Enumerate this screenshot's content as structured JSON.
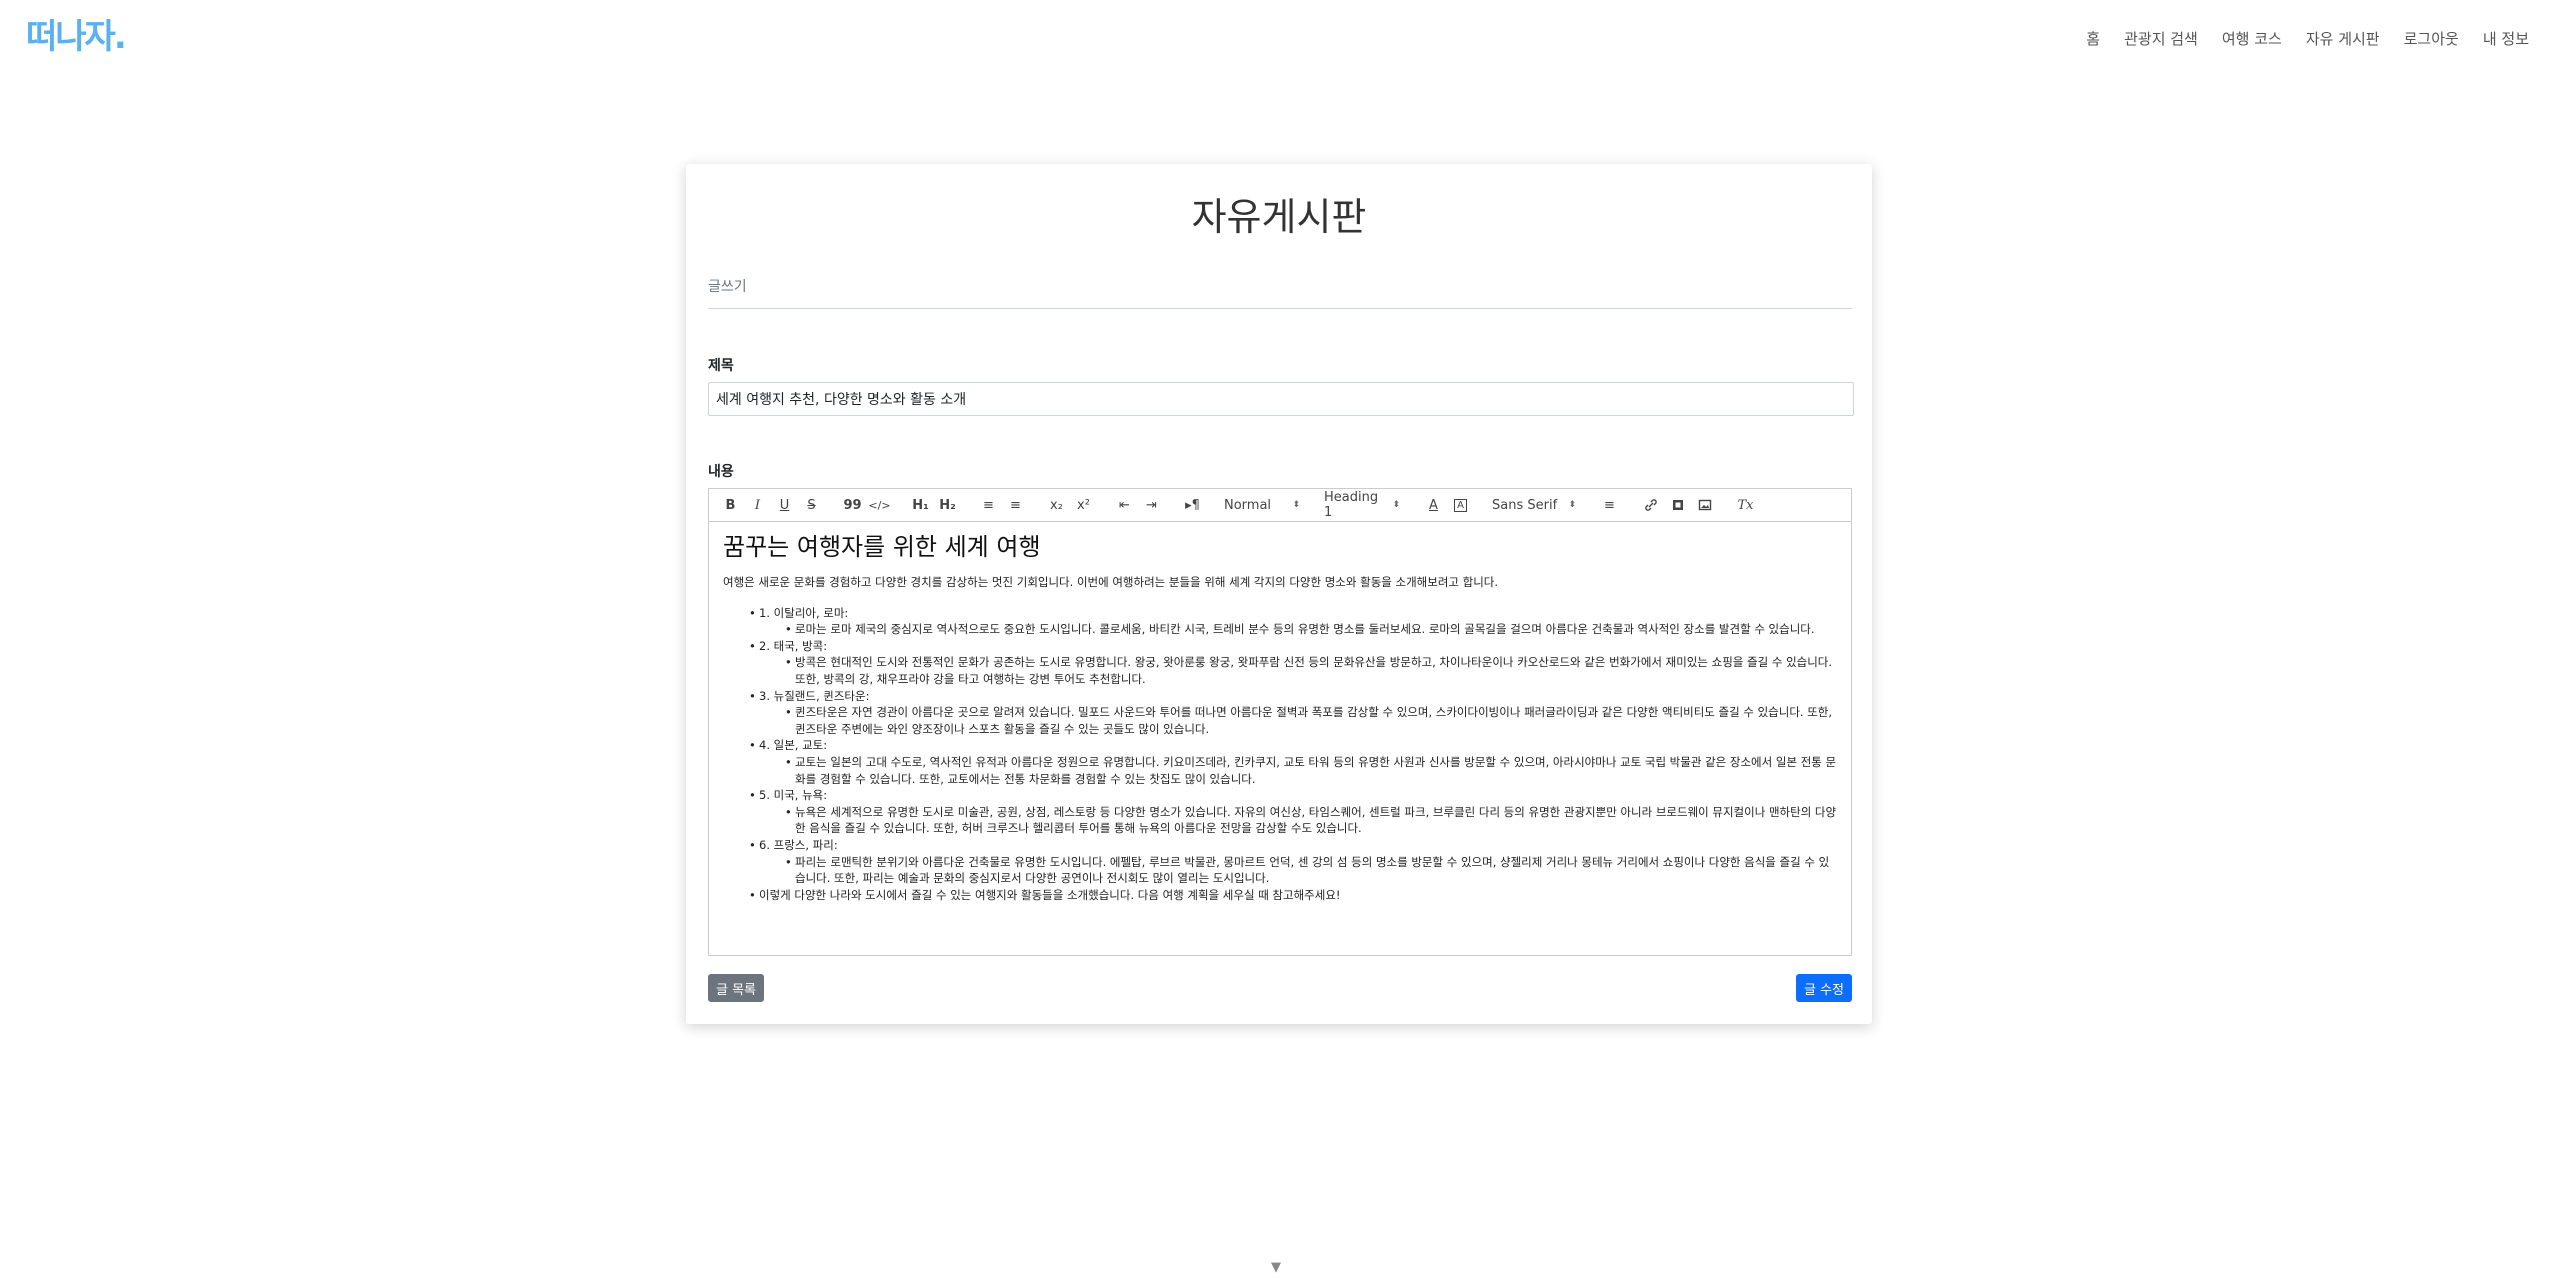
{
  "navbar": {
    "logo_text": "떠나자.",
    "items": [
      {
        "label": "홈"
      },
      {
        "label": "관광지 검색"
      },
      {
        "label": "여행 코스"
      },
      {
        "label": "자유 게시판"
      },
      {
        "label": "로그아웃"
      },
      {
        "label": "내 정보"
      }
    ]
  },
  "page": {
    "board_title": "자유게시판",
    "write_label": "글쓰기",
    "title_label": "제목",
    "title_value": "세계 여행지 추천, 다양한 명소와 활동 소개",
    "content_label": "내용"
  },
  "toolbar": {
    "bold": "B",
    "italic": "I",
    "underline": "U",
    "strike": "S",
    "blockquote": "99",
    "code": "</>",
    "h1": "H₁",
    "h2": "H₂",
    "ordered_list": "≡",
    "bullet_list": "≡",
    "subscript": "x₂",
    "superscript": "x²",
    "outdent": "⇤",
    "indent": "⇥",
    "rtl": "▸¶",
    "size_select": "Normal",
    "header_select": "Heading 1",
    "color": "A",
    "background": "A",
    "font_select": "Sans Serif",
    "align": "≡",
    "link": "🔗",
    "video": "▣",
    "image": "▨",
    "clean": "Tx"
  },
  "content": {
    "heading": "꿈꾸는 여행자를 위한 세계 여행",
    "intro": "여행은 새로운 문화를 경험하고 다양한 경치를 감상하는 멋진 기회입니다. 이번에 여행하려는 분들을 위해 세계 각지의 다양한 명소와 활동을 소개해보려고 합니다.",
    "items": [
      {
        "title": "1. 이탈리아, 로마:",
        "detail": "로마는 로마 제국의 중심지로 역사적으로도 중요한 도시입니다. 콜로세움, 바티칸 시국, 트레비 분수 등의 유명한 명소를 둘러보세요. 로마의 골목길을 걸으며 아름다운 건축물과 역사적인 장소를 발견할 수 있습니다."
      },
      {
        "title": "2. 태국, 방콕:",
        "detail": "방콕은 현대적인 도시와 전통적인 문화가 공존하는 도시로 유명합니다. 왕궁, 왓아룬룽 왕궁, 왓파푸람 신전 등의 문화유산을 방문하고, 차이나타운이나 카오산로드와 같은 번화가에서 재미있는 쇼핑을 즐길 수 있습니다. 또한, 방콕의 강, 채우프라야 강을 타고 여행하는 강변 투어도 추천합니다."
      },
      {
        "title": "3. 뉴질랜드, 퀸즈타운:",
        "detail": "퀸즈타운은 자연 경관이 아름다운 곳으로 알려져 있습니다. 밀포드 사운드와 투어를 떠나면 아름다운 절벽과 폭포를 감상할 수 있으며, 스카이다이빙이나 패러글라이딩과 같은 다양한 액티비티도 즐길 수 있습니다. 또한, 퀸즈타운 주변에는 와인 양조장이나 스포츠 활동을 즐길 수 있는 곳들도 많이 있습니다."
      },
      {
        "title": "4. 일본, 교토:",
        "detail": "교토는 일본의 고대 수도로, 역사적인 유적과 아름다운 정원으로 유명합니다. 키요미즈데라, 킨카쿠지, 교토 타워 등의 유명한 사원과 신사를 방문할 수 있으며, 아라시야마나 교토 국립 박물관 같은 장소에서 일본 전통 문화를 경험할 수 있습니다. 또한, 교토에서는 전통 차문화를 경험할 수 있는 찻집도 많이 있습니다."
      },
      {
        "title": "5. 미국, 뉴욕:",
        "detail": "뉴욕은 세계적으로 유명한 도시로 미술관, 공원, 상점, 레스토랑 등 다양한 명소가 있습니다. 자유의 여신상, 타임스퀘어, 센트럴 파크, 브루클린 다리 등의 유명한 관광지뿐만 아니라 브로드웨이 뮤지컬이나 맨하탄의 다양한 음식을 즐길 수 있습니다. 또한, 허버 크루즈나 헬리콥터 투어를 통해 뉴욕의 아름다운 전망을 감상할 수도 있습니다."
      },
      {
        "title": "6. 프랑스, 파리:",
        "detail": "파리는 로맨틱한 분위기와 아름다운 건축물로 유명한 도시입니다. 에펠탑, 루브르 박물관, 몽마르트 언덕, 센 강의 섬 등의 명소를 방문할 수 있으며, 샹젤리제 거리나 몽테뉴 거리에서 쇼핑이나 다양한 음식을 즐길 수 있습니다. 또한, 파리는 예술과 문화의 중심지로서 다양한 공연이나 전시회도 많이 열리는 도시입니다."
      }
    ],
    "closing": "이렇게 다양한 나라와 도시에서 즐길 수 있는 여행지와 활동들을 소개했습니다. 다음 여행 계획을 세우실 때 참고해주세요!"
  },
  "buttons": {
    "list": "글 목록",
    "edit": "글 수정"
  },
  "scroll_arrow": "▼"
}
